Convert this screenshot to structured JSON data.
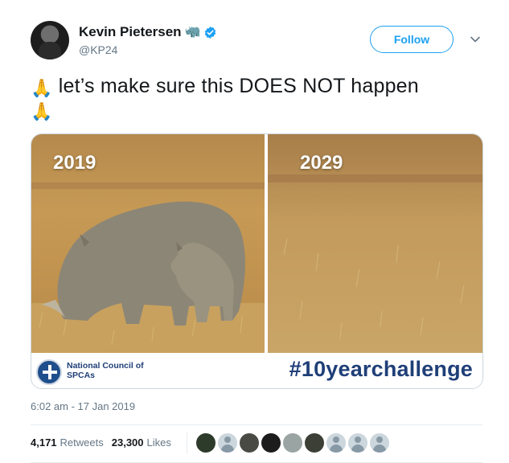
{
  "author": {
    "display_name": "Kevin Pietersen",
    "name_emoji": "🦏",
    "handle": "@KP24",
    "verified": true
  },
  "actions": {
    "follow_label": "Follow"
  },
  "tweet": {
    "emoji": "🙏",
    "text": "let’s make sure this DOES NOT happen",
    "timestamp": "6:02 am - 17 Jan 2019"
  },
  "media": {
    "left_year": "2019",
    "right_year": "2029",
    "organization": "National Council of SPCAs",
    "hashtag": "#10yearchallenge"
  },
  "stats": {
    "retweets_count": "4,171",
    "retweets_label": "Retweets",
    "likes_count": "23,300",
    "likes_label": "Likes"
  },
  "likers": [
    {
      "icon": "user-avatar-photo"
    },
    {
      "icon": "default-avatar-icon"
    },
    {
      "icon": "user-avatar-photo"
    },
    {
      "icon": "user-avatar-photo"
    },
    {
      "icon": "user-avatar-photo"
    },
    {
      "icon": "user-avatar-photo"
    },
    {
      "icon": "default-avatar-icon"
    },
    {
      "icon": "default-avatar-icon"
    },
    {
      "icon": "default-avatar-icon"
    }
  ],
  "colors": {
    "link_blue": "#1da1f2",
    "muted_gray": "#657786",
    "banner_navy": "#1f3f78"
  }
}
